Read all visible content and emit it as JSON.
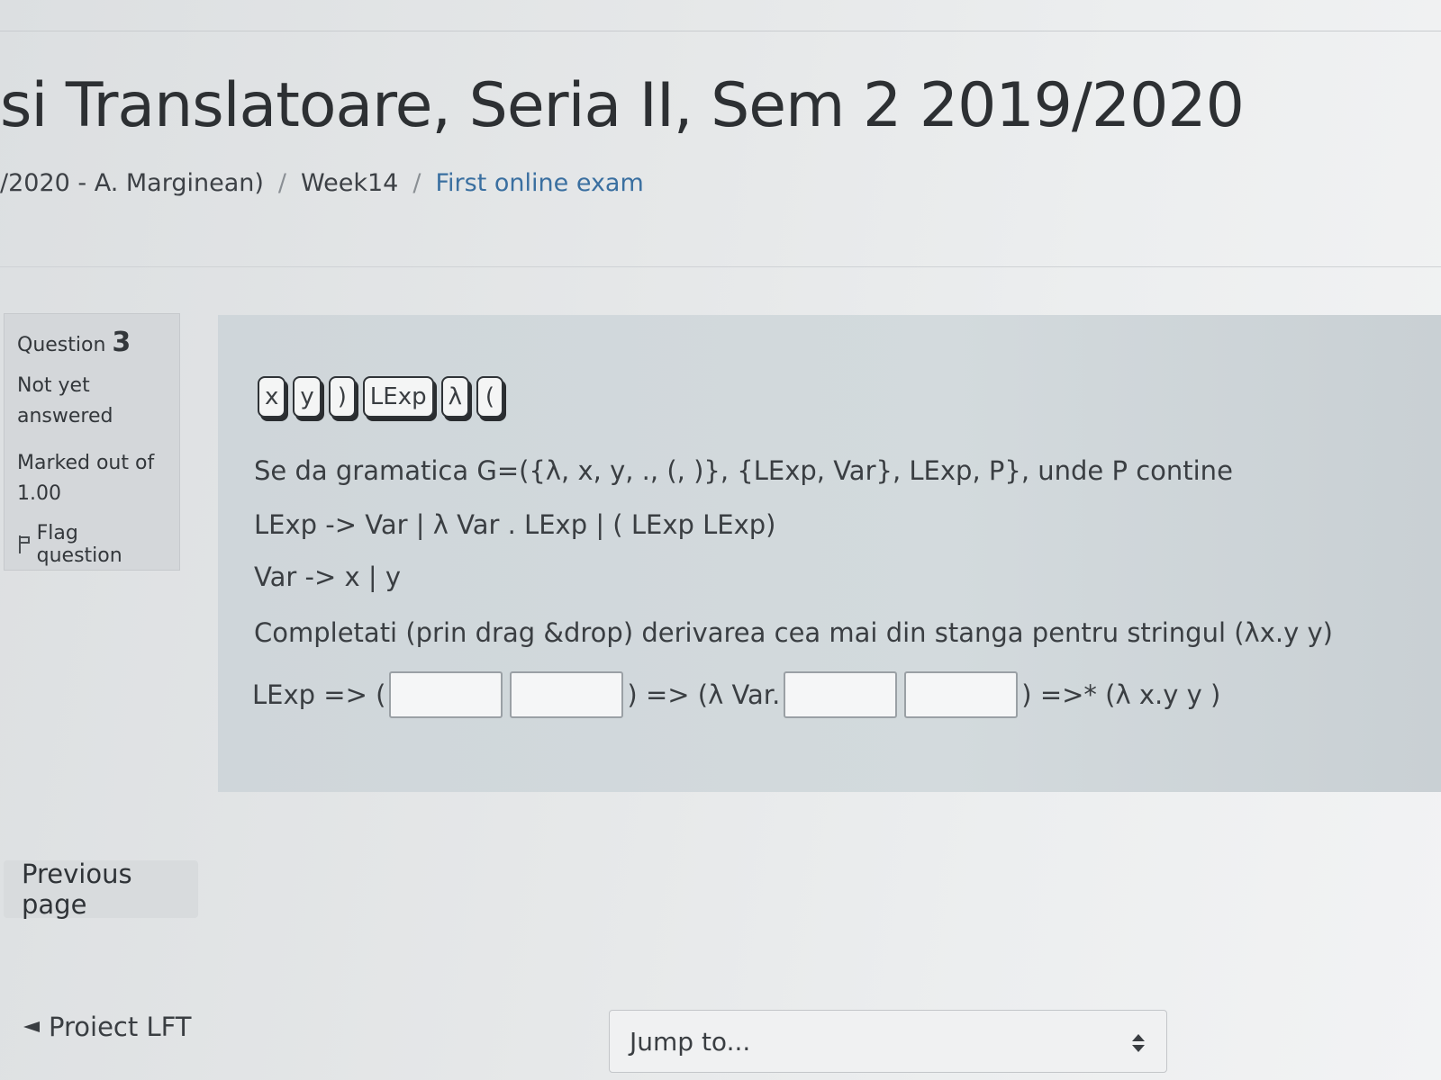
{
  "header": {
    "course_title": "si Translatoare, Seria II, Sem 2 2019/2020",
    "breadcrumb": {
      "item1": "/2020 - A. Marginean)",
      "sep": "/",
      "item2": "Week14",
      "current": "First online exam"
    }
  },
  "question_info": {
    "label": "Question",
    "number": "3",
    "state": "Not yet answered",
    "marks": "Marked out of 1.00",
    "flag_label": "Flag question"
  },
  "drag_items": [
    "x",
    "y",
    ")",
    "LExp",
    "λ",
    "("
  ],
  "question_text": {
    "line1": "Se da gramatica G=({λ, x, y, ., (, )}, {LExp, Var}, LExp, P}, unde P contine",
    "line2": "LExp -> Var | λ Var . LExp | ( LExp LExp)",
    "line3": "Var -> x | y",
    "line4": "Completati (prin drag &drop) derivarea cea mai din stanga pentru stringul (λx.y   y)"
  },
  "answer_row": {
    "part1": "LExp => (",
    "part2": ") => (λ Var.",
    "part3": ") =>* (λ x.y y )"
  },
  "navigation": {
    "previous_page": "Previous page",
    "previous_activity": "Proiect LFT",
    "jump_to": "Jump to..."
  }
}
